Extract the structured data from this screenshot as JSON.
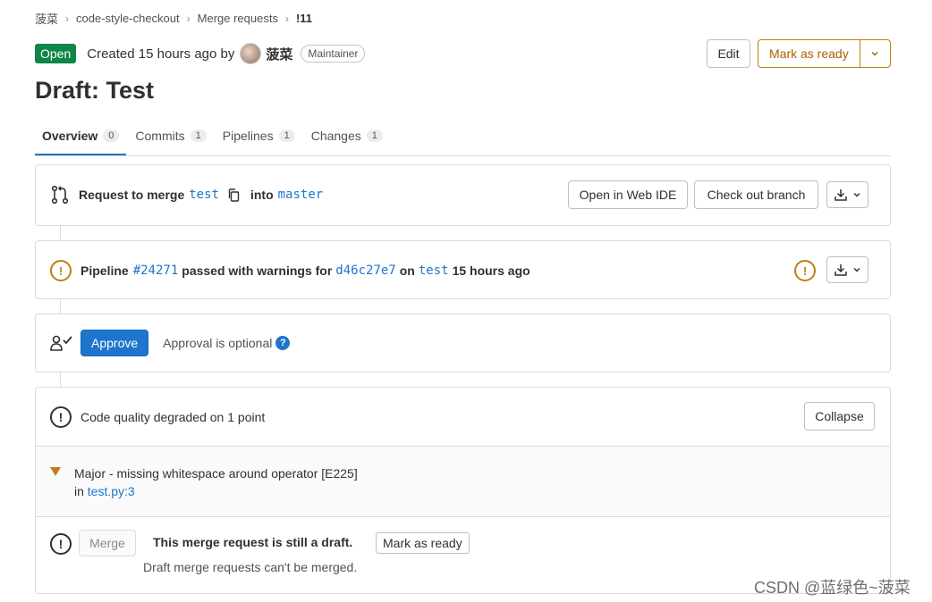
{
  "breadcrumb": [
    "菠菜",
    "code-style-checkout",
    "Merge requests",
    "!11"
  ],
  "header": {
    "status": "Open",
    "created_text": "Created 15 hours ago by",
    "author": "菠菜",
    "role": "Maintainer",
    "edit_label": "Edit",
    "mark_ready_label": "Mark as ready"
  },
  "title": "Draft: Test",
  "tabs": [
    {
      "label": "Overview",
      "count": "0"
    },
    {
      "label": "Commits",
      "count": "1"
    },
    {
      "label": "Pipelines",
      "count": "1"
    },
    {
      "label": "Changes",
      "count": "1"
    }
  ],
  "merge_info": {
    "prefix": "Request to merge",
    "source_branch": "test",
    "into": "into",
    "target_branch": "master",
    "web_ide_label": "Open in Web IDE",
    "checkout_label": "Check out branch"
  },
  "pipeline": {
    "prefix": "Pipeline",
    "id": "#24271",
    "status_text": "passed with warnings for",
    "commit": "d46c27e7",
    "on": "on",
    "branch": "test",
    "time": "15 hours ago"
  },
  "approval": {
    "approve_label": "Approve",
    "optional_text": "Approval is optional",
    "help_glyph": "?"
  },
  "code_quality": {
    "summary": "Code quality degraded on 1 point",
    "collapse_label": "Collapse",
    "issue_text": "Major - missing whitespace around operator [E225]",
    "in_text": "in",
    "location": "test.py:3"
  },
  "merge_section": {
    "merge_label": "Merge",
    "draft_title": "This merge request is still a draft.",
    "mark_ready_label": "Mark as ready",
    "draft_note": "Draft merge requests can't be merged."
  },
  "watermark": "CSDN @蓝绿色~菠菜",
  "colors": {
    "accent": "#1f75cb",
    "open": "#108548",
    "warning": "#c17d10"
  }
}
